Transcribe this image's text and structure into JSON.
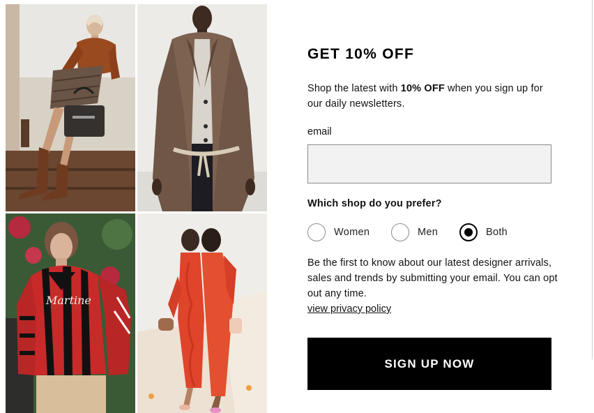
{
  "signup": {
    "title": "GET 10% OFF",
    "intro_prefix": "Shop the latest with ",
    "intro_bold": "10% OFF",
    "intro_suffix": " when you sign up for our daily newsletters.",
    "email_label": "email",
    "email_value": "",
    "shop_question": "Which shop do you prefer?",
    "shop_options": [
      {
        "label": "Women",
        "selected": false
      },
      {
        "label": "Men",
        "selected": false
      },
      {
        "label": "Both",
        "selected": true
      }
    ],
    "body": "Be the first to know about our latest designer arrivals, sales and trends by submitting your email. You can opt out any time.",
    "privacy_link": "view privacy policy",
    "submit_label": "SIGN UP NOW"
  },
  "photos": [
    {
      "name": "model-brown-sweater-handbag"
    },
    {
      "name": "model-tweed-overcoat"
    },
    {
      "name": "model-striped-football-shirt",
      "shirt_text": "Martine"
    },
    {
      "name": "models-red-dresses"
    }
  ],
  "colors": {
    "button_bg": "#000000",
    "button_text": "#ffffff",
    "input_bg": "#f2f2f2",
    "text": "#111111"
  }
}
